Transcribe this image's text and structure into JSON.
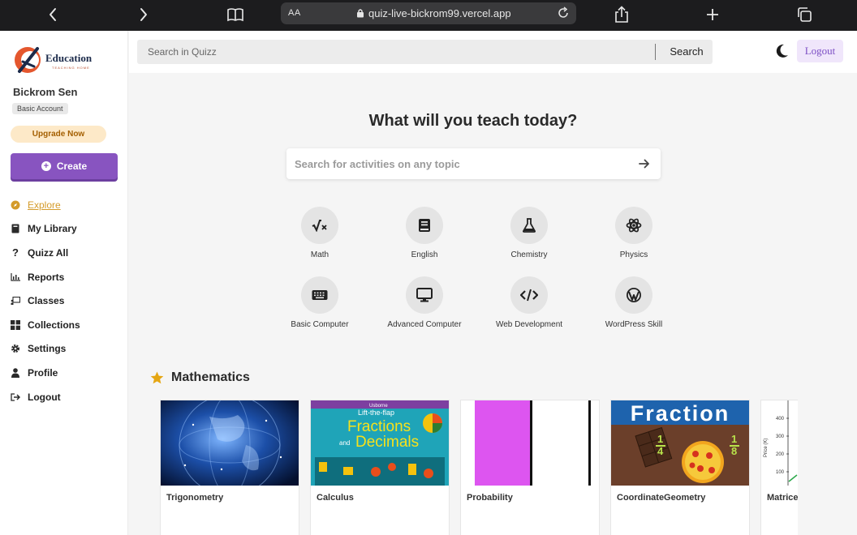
{
  "browser": {
    "text_size_label": "AA",
    "url": "quiz-live-bickrom99.vercel.app"
  },
  "sidebar": {
    "brand": "Education",
    "brand_tagline": "TEACHING HOME",
    "user_name": "Bickrom Sen",
    "account_type": "Basic Account",
    "upgrade_label": "Upgrade Now",
    "create_label": "Create",
    "nav": [
      {
        "label": "Explore",
        "icon": "compass-icon",
        "active": true
      },
      {
        "label": "My Library",
        "icon": "book-icon"
      },
      {
        "label": "Quizz All",
        "icon": "question-icon"
      },
      {
        "label": "Reports",
        "icon": "chart-icon"
      },
      {
        "label": "Classes",
        "icon": "chalkboard-icon"
      },
      {
        "label": "Collections",
        "icon": "grid-icon"
      },
      {
        "label": "Settings",
        "icon": "gear-icon"
      },
      {
        "label": "Profile",
        "icon": "user-icon"
      },
      {
        "label": "Logout",
        "icon": "logout-icon"
      }
    ]
  },
  "topbar": {
    "search_placeholder": "Search in Quizz",
    "search_button": "Search",
    "logout_label": "Logout"
  },
  "main": {
    "hero_title": "What will you teach today?",
    "hero_search_placeholder": "Search for activities on any topic",
    "subjects": [
      {
        "label": "Math",
        "icon": "square-root-icon"
      },
      {
        "label": "English",
        "icon": "book-icon"
      },
      {
        "label": "Chemistry",
        "icon": "flask-icon"
      },
      {
        "label": "Physics",
        "icon": "atom-icon"
      },
      {
        "label": "Basic Computer",
        "icon": "keyboard-icon"
      },
      {
        "label": "Advanced Computer",
        "icon": "desktop-icon"
      },
      {
        "label": "Web Development",
        "icon": "code-icon"
      },
      {
        "label": "WordPress Skill",
        "icon": "wordpress-icon"
      }
    ],
    "section_title": "Mathematics",
    "cards": [
      {
        "title": "Trigonometry"
      },
      {
        "title": "Calculus",
        "thumb_texts": [
          "Usborne",
          "Lift-the-flap",
          "Fractions",
          "and",
          "Decimals"
        ]
      },
      {
        "title": "Probability"
      },
      {
        "title": "CoordinateGeometry",
        "thumb_texts": [
          "Fraction",
          "1",
          "4",
          "1",
          "8"
        ]
      },
      {
        "title": "Matrices",
        "thumb_texts": [
          "Price (K)",
          "400",
          "300",
          "200",
          "100"
        ]
      }
    ]
  },
  "colors": {
    "accent_purple": "#8854c0",
    "explore_active": "#d49b2a",
    "upgrade_bg": "#fde9c8"
  }
}
